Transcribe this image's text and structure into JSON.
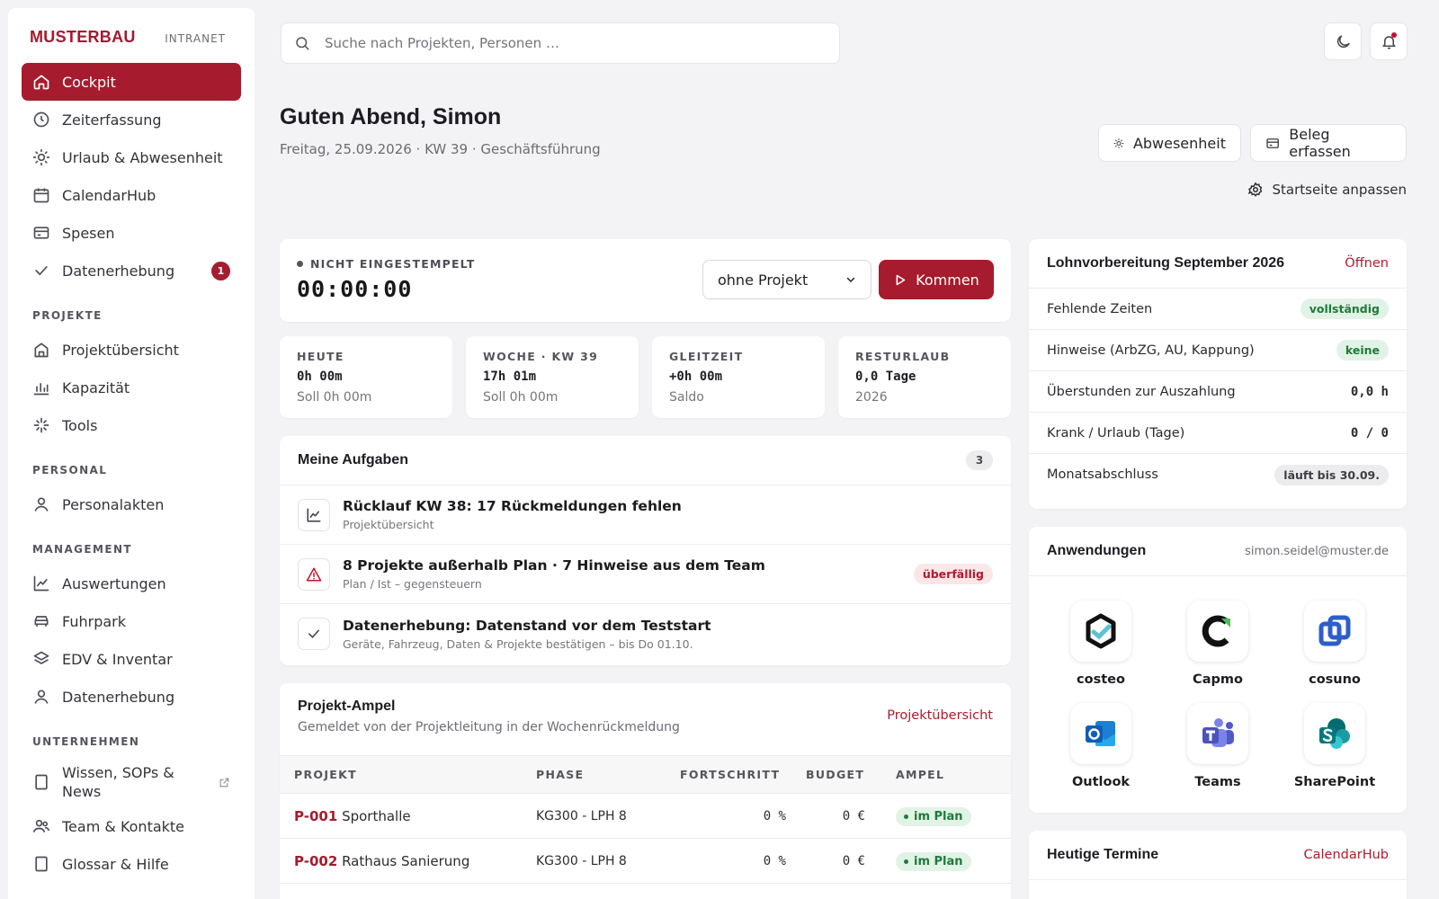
{
  "brand": {
    "name": "MUSTERBAU",
    "sub": "INTRANET"
  },
  "sidebar": {
    "main": [
      {
        "label": "Cockpit"
      },
      {
        "label": "Zeiterfassung"
      },
      {
        "label": "Urlaub & Abwesenheit"
      },
      {
        "label": "CalendarHub"
      },
      {
        "label": "Spesen"
      },
      {
        "label": "Datenerhebung",
        "badge": "1"
      }
    ],
    "sections": {
      "projekte": "PROJEKTE",
      "personal": "PERSONAL",
      "management": "MANAGEMENT",
      "unternehmen": "UNTERNEHMEN"
    },
    "projekte": [
      "Projektübersicht",
      "Kapazität",
      "Tools"
    ],
    "personal": [
      "Personalakten"
    ],
    "management": [
      "Auswertungen",
      "Fuhrpark",
      "EDV & Inventar",
      "Datenerhebung"
    ],
    "unternehmen": [
      "Wissen, SOPs & News",
      "Team & Kontakte",
      "Glossar & Hilfe"
    ]
  },
  "search": {
    "placeholder": "Suche nach Projekten, Personen …"
  },
  "header": {
    "greeting": "Guten Abend, Simon",
    "subline": "Freitag, 25.09.2026 · KW 39 · Geschäftsführung",
    "absence_button": "Abwesenheit",
    "receipt_button": "Beleg erfassen",
    "customize": "Startseite anpassen"
  },
  "stamp": {
    "status": "NICHT EINGESTEMPELT",
    "timer": "00:00:00",
    "project_select": "ohne Projekt",
    "action": "Kommen"
  },
  "stats": [
    {
      "label": "HEUTE",
      "value": "0h 00m",
      "sub": "Soll 0h 00m"
    },
    {
      "label": "WOCHE · KW 39",
      "value": "17h 01m",
      "sub": "Soll 0h 00m"
    },
    {
      "label": "GLEITZEIT",
      "value": "+0h 00m",
      "sub": "Saldo"
    },
    {
      "label": "RESTURLAUB",
      "value": "0,0 Tage",
      "sub": "2026"
    }
  ],
  "tasks": {
    "title": "Meine Aufgaben",
    "count": "3",
    "items": [
      {
        "title": "Rücklauf KW 38: 17 Rückmeldungen fehlen",
        "sub": "Projektübersicht",
        "badge": ""
      },
      {
        "title": "8 Projekte außerhalb Plan · 7 Hinweise aus dem Team",
        "sub": "Plan / Ist – gegensteuern",
        "badge": "überfällig"
      },
      {
        "title": "Datenerhebung: Datenstand vor dem Teststart",
        "sub": "Geräte, Fahrzeug, Daten & Projekte bestätigen – bis Do 01.10.",
        "badge": ""
      }
    ]
  },
  "ampel": {
    "title": "Projekt-Ampel",
    "subtitle": "Gemeldet von der Projektleitung in der Wochenrückmeldung",
    "link": "Projektübersicht",
    "columns": [
      "PROJEKT",
      "PHASE",
      "FORTSCHRITT",
      "BUDGET",
      "AMPEL"
    ],
    "rows": [
      {
        "id": "P-001",
        "name": "Sporthalle",
        "phase": "KG300 - LPH 8",
        "progress": "0 %",
        "budget": "0 €",
        "status": "im Plan"
      },
      {
        "id": "P-002",
        "name": "Rathaus Sanierung",
        "phase": "KG300 - LPH 8",
        "progress": "0 %",
        "budget": "0 €",
        "status": "im Plan"
      }
    ]
  },
  "lohn": {
    "title": "Lohnvorbereitung September 2026",
    "link": "Öffnen",
    "rows": [
      {
        "label": "Fehlende Zeiten",
        "value": "vollständig"
      },
      {
        "label": "Hinweise (ArbZG, AU, Kappung)",
        "value": "keine"
      },
      {
        "label": "Überstunden zur Auszahlung",
        "value": "0,0 h"
      },
      {
        "label": "Krank / Urlaub (Tage)",
        "value": "0 / 0"
      },
      {
        "label": "Monatsabschluss",
        "value": "läuft bis 30.09."
      }
    ]
  },
  "apps": {
    "title": "Anwendungen",
    "email": "simon.seidel@muster.de",
    "items": [
      {
        "name": "costeo",
        "icon": "costeo-icon"
      },
      {
        "name": "Capmo",
        "icon": "capmo-icon"
      },
      {
        "name": "cosuno",
        "icon": "cosuno-icon"
      },
      {
        "name": "Outlook",
        "icon": "outlook-icon"
      },
      {
        "name": "Teams",
        "icon": "teams-icon"
      },
      {
        "name": "SharePoint",
        "icon": "sharepoint-icon"
      }
    ]
  },
  "termine": {
    "title": "Heutige Termine",
    "link": "CalendarHub"
  },
  "colors": {
    "accent": "#a61b2d",
    "success": "#1f7a3a",
    "background": "#f3f3f5"
  }
}
